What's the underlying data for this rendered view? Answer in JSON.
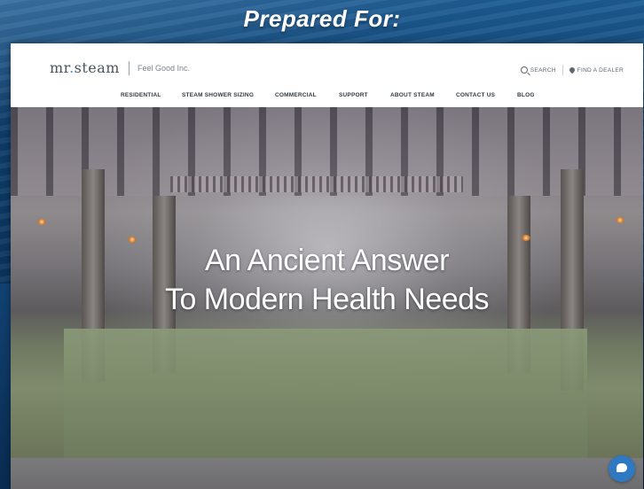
{
  "banner": {
    "title": "Prepared For:"
  },
  "header": {
    "logo": {
      "text_left": "mr",
      "dot": ".",
      "text_right": "steam"
    },
    "tagline": "Feel Good Inc.",
    "search_label": "SEARCH",
    "dealer_label": "FIND A DEALER"
  },
  "nav": {
    "items": [
      {
        "label": "RESIDENTIAL"
      },
      {
        "label": "STEAM SHOWER SIZING"
      },
      {
        "label": "COMMERCIAL"
      },
      {
        "label": "SUPPORT"
      },
      {
        "label": "ABOUT STEAM"
      },
      {
        "label": "CONTACT US"
      },
      {
        "label": "BLOG"
      }
    ]
  },
  "hero": {
    "line1": "An Ancient Answer",
    "line2": "To Modern Health Needs"
  },
  "icons": {
    "search": "search-icon",
    "dealer": "map-pin-icon",
    "chat": "chat-icon"
  },
  "colors": {
    "accent": "#2e79c2",
    "nav_text": "#2f3a44",
    "banner_bg": "#154a7d"
  }
}
